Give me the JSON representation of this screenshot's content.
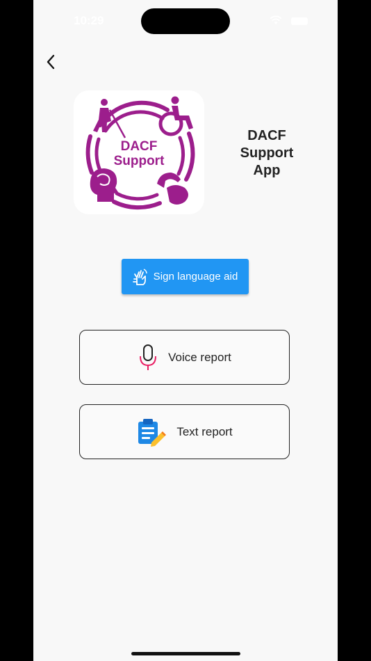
{
  "status_bar": {
    "time": "10:29"
  },
  "header": {
    "back_icon": "chevron-left-icon"
  },
  "logo": {
    "line1": "DACF",
    "line2": "Support",
    "color": "#9c1e8c"
  },
  "app_title": {
    "line1": "DACF",
    "line2": "Support",
    "line3": "App"
  },
  "buttons": {
    "sign_language": {
      "label": "Sign language aid",
      "icon": "sign-language-icon",
      "color": "#2196f3"
    },
    "voice_report": {
      "label": "Voice report",
      "icon": "microphone-icon",
      "icon_color": "#e91e63"
    },
    "text_report": {
      "label": "Text report",
      "icon": "clipboard-edit-icon"
    }
  }
}
